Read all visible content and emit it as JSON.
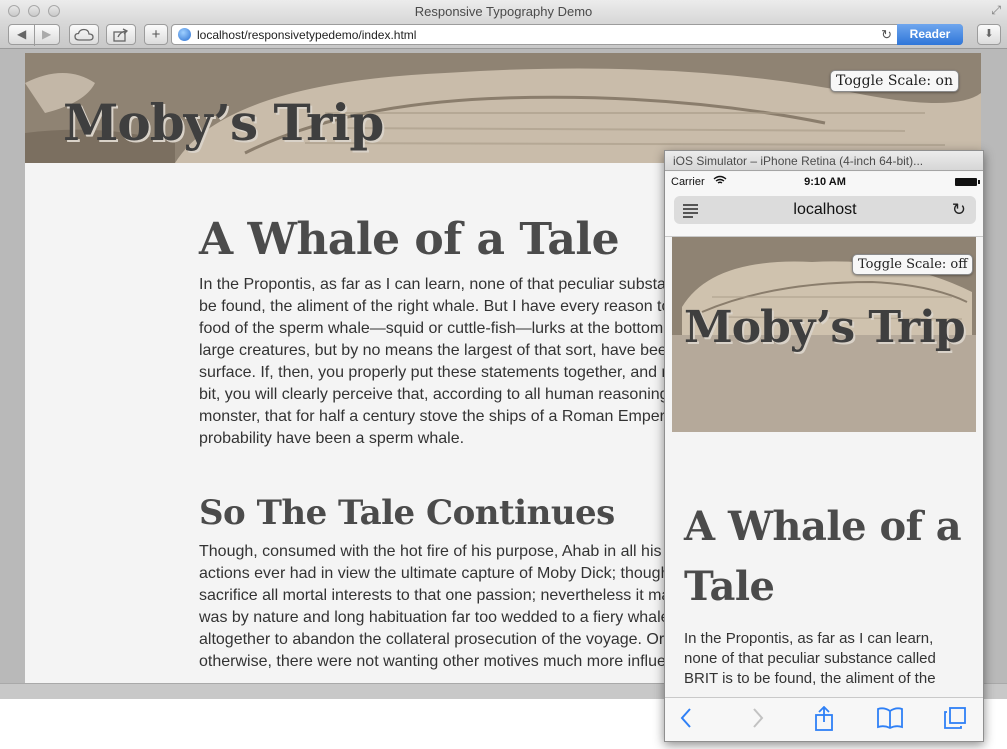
{
  "window": {
    "title": "Responsive Typography Demo",
    "url": "localhost/responsivetypedemo/index.html",
    "reader_label": "Reader"
  },
  "toolbar": {
    "back_icon": "back-arrow-icon",
    "forward_icon": "forward-arrow-icon",
    "icloud_icon": "cloud-icon",
    "share_icon": "share-icon",
    "add_icon": "plus-icon",
    "reload_icon": "reload-icon",
    "downloads_icon": "downloads-icon"
  },
  "page": {
    "site_title": "Moby’s Trip",
    "toggle_label": "Toggle Scale: on",
    "heading1": "A Whale of a Tale",
    "paragraph1_lines": [
      "In the Propontis, as far as I can learn, none of that peculiar substan",
      "be found, the aliment of the right whale. But I have every reason to",
      "food of the sperm whale—squid or cuttle-fish—lurks at the bottom",
      "large creatures, but by no means the largest of that sort, have been",
      "surface. If, then, you properly put these statements together, and re",
      "bit, you will clearly perceive that, according to all human reasoning,",
      "monster, that for half a century stove the ships of a Roman Empero",
      "probability have been a sperm whale."
    ],
    "heading2": "So The Tale Continues",
    "paragraph2_lines": [
      "Though, consumed with the hot fire of his purpose, Ahab in all his t",
      "actions ever had in view the ultimate capture of Moby Dick; though",
      "sacrifice all mortal interests to that one passion; nevertheless it ma",
      "was by nature and long habituation far too wedded to a fiery whale",
      "altogether to abandon the collateral prosecution of the voyage. Or a",
      "otherwise, there were not wanting other motives much more influe"
    ]
  },
  "simulator": {
    "window_title": "iOS Simulator – iPhone Retina (4-inch 64-bit)...",
    "carrier": "Carrier",
    "time": "9:10 AM",
    "host": "localhost",
    "toggle_label": "Toggle Scale: off",
    "site_title": "Moby’s Trip",
    "heading1": "A Whale of a Tale",
    "paragraph_lines": [
      "In the Propontis, as far as I can learn,",
      "none of that peculiar substance called",
      "BRIT is to be found, the aliment of the"
    ],
    "toolbar_icons": [
      "back-icon",
      "forward-icon",
      "share-icon",
      "bookmarks-icon",
      "tabs-icon"
    ]
  },
  "colors": {
    "reader_blue": "#2f76d9",
    "ios_blue": "#2f80f6",
    "heading_gray": "#4b4b4b",
    "hero_tan": "#8d8173"
  }
}
